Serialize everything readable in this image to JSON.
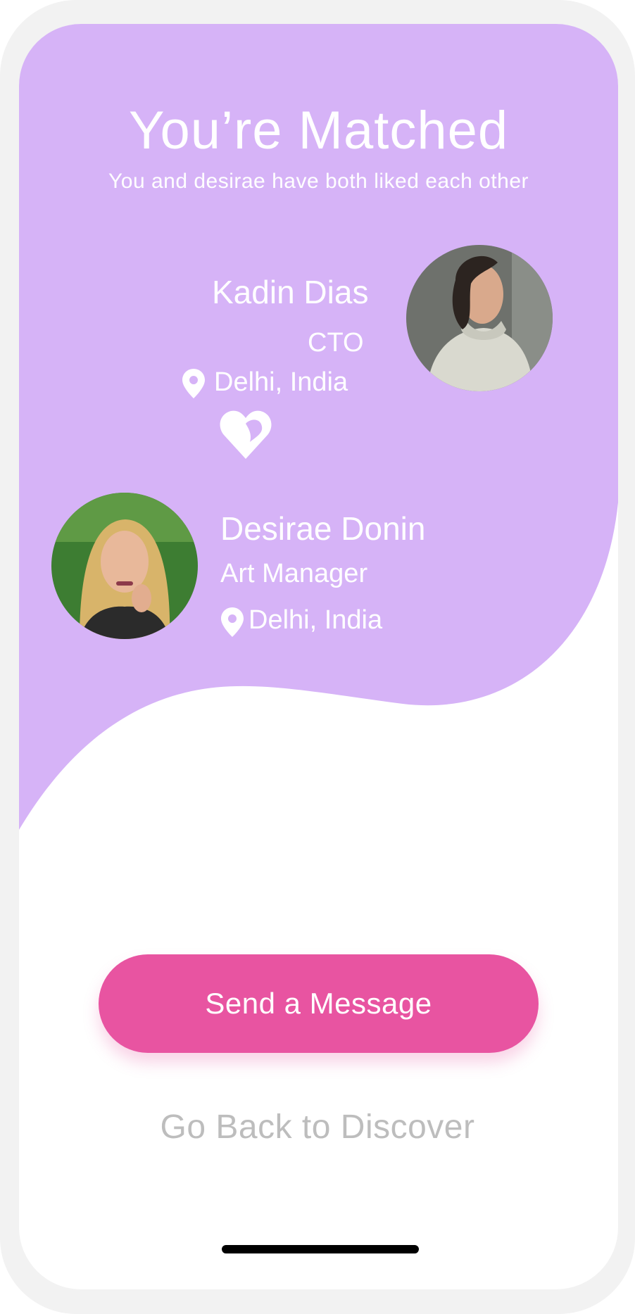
{
  "colors": {
    "purple": "#d6b3f7",
    "pink": "#e854a1",
    "muted": "#bdbdbd"
  },
  "match": {
    "title": "You’re Matched",
    "subtitle": "You and desirae have both liked each other"
  },
  "user": {
    "name": "Kadin Dias",
    "role": "CTO",
    "location": "Delhi, India",
    "location_icon": "location-pin-icon",
    "avatar_icon": "user-photo"
  },
  "heart_icon": "heart-icon",
  "partner": {
    "name": "Desirae Donin",
    "role": "Art Manager",
    "location": "Delhi, India",
    "location_icon": "location-pin-icon",
    "avatar_icon": "user-photo"
  },
  "actions": {
    "send_message": "Send a Message",
    "go_back": "Go Back to Discover"
  }
}
